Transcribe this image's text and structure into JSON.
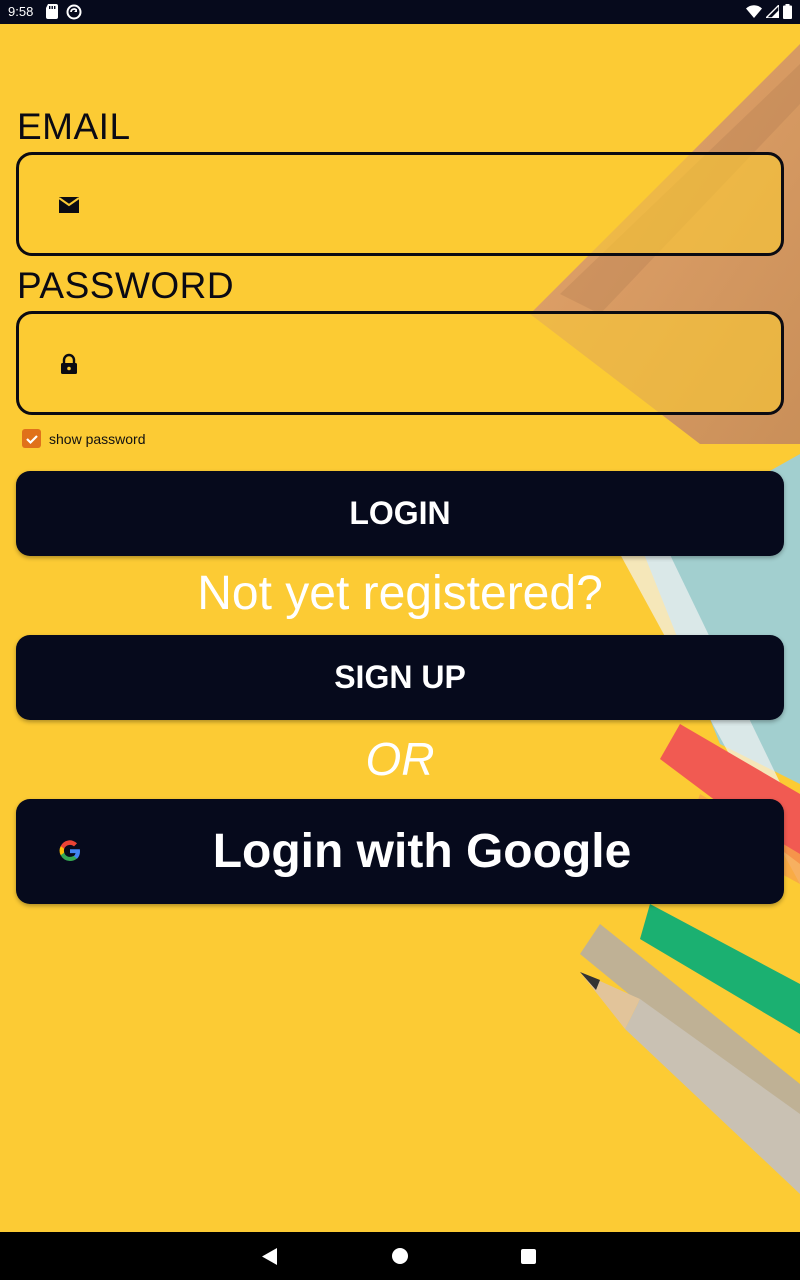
{
  "status_bar": {
    "time": "9:58",
    "left_icons": [
      "sd-card-icon",
      "sync-icon"
    ],
    "right_icons": [
      "wifi-icon",
      "signal-icon",
      "battery-icon"
    ]
  },
  "form": {
    "email_label": "EMAIL",
    "email_value": "",
    "email_icon": "email-icon",
    "password_label": "PASSWORD",
    "password_value": "",
    "password_icon": "lock-icon",
    "show_password_label": "show password",
    "show_password_checked": true
  },
  "buttons": {
    "login_label": "LOGIN",
    "not_registered_text": "Not yet registered?",
    "signup_label": "SIGN UP",
    "or_text": "OR",
    "google_label": "Login with Google",
    "google_icon": "google-icon"
  },
  "nav_bar": {
    "icons": [
      "back-icon",
      "home-icon",
      "recents-icon"
    ]
  },
  "colors": {
    "background": "#fccb34",
    "button": "#060a1c",
    "checkbox": "#e0711a"
  }
}
